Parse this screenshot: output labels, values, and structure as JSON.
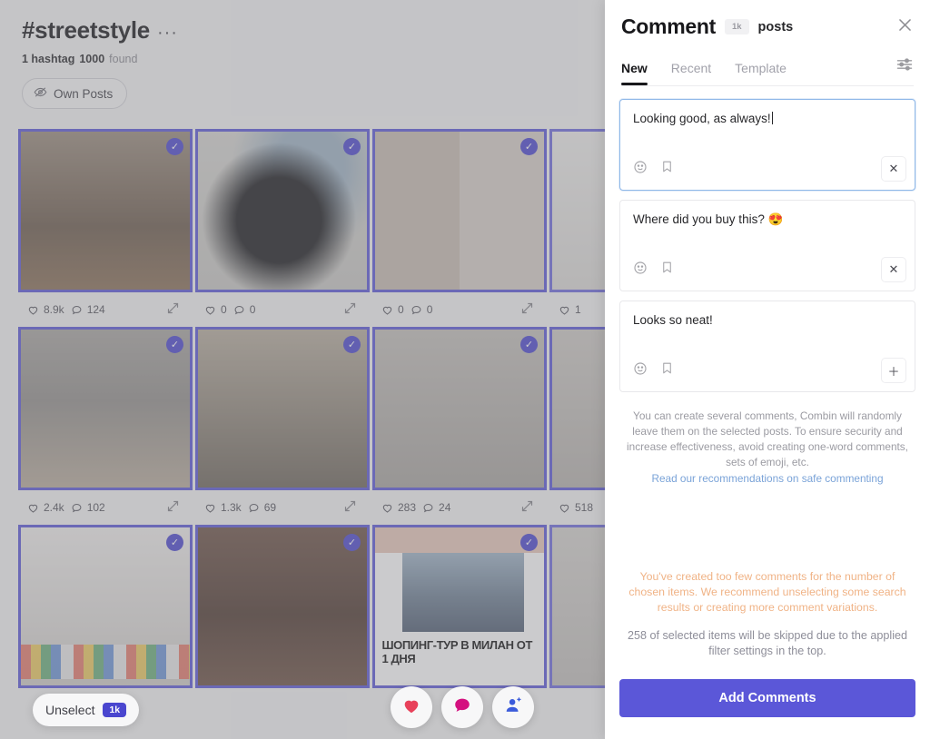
{
  "results": {
    "hashtag_title": "#streetstyle",
    "more_glyph": "···",
    "meta_count_label": "1 hashtag",
    "meta_found_value": "1000",
    "meta_found_label": "found",
    "own_posts_label": "Own Posts",
    "unselect_label": "Unselect",
    "unselect_count": "1k",
    "selected_check": "✓",
    "posts": [
      {
        "likes": "8.9k",
        "comments": "124",
        "selected": true,
        "thumb": "woman-on-bench-autumn"
      },
      {
        "likes": "0",
        "comments": "0",
        "selected": true,
        "thumb": "black-beanies-hoodie"
      },
      {
        "likes": "0",
        "comments": "0",
        "selected": true,
        "thumb": "floral-dress-collage"
      },
      {
        "likes": "1",
        "comments": "",
        "selected": false,
        "thumb": "white-interior"
      },
      {
        "likes": "2.4k",
        "comments": "102",
        "selected": true,
        "thumb": "beige-outfit-street"
      },
      {
        "likes": "1.3k",
        "comments": "69",
        "selected": true,
        "thumb": "floral-coat-canal"
      },
      {
        "likes": "283",
        "comments": "24",
        "selected": true,
        "thumb": "red-dress-stairs"
      },
      {
        "likes": "518",
        "comments": "",
        "selected": true,
        "thumb": "black-outfit"
      },
      {
        "likes": "",
        "comments": "",
        "selected": true,
        "thumb": "gallery-corridor"
      },
      {
        "likes": "",
        "comments": "",
        "selected": true,
        "thumb": "man-cafe-white-shirt"
      },
      {
        "likes": "",
        "comments": "",
        "selected": true,
        "thumb": "shopping-tour-poster"
      },
      {
        "likes": "",
        "comments": "",
        "selected": false,
        "thumb": "storefront"
      }
    ],
    "fabs": [
      {
        "name": "like-fab",
        "icon": "heart-icon",
        "color": "#e8415a"
      },
      {
        "name": "comment-fab",
        "icon": "comment-icon",
        "color": "#d4107f"
      },
      {
        "name": "follow-fab",
        "icon": "user-plus-icon",
        "color": "#3b5bdb"
      }
    ]
  },
  "panel": {
    "title": "Comment",
    "count_badge": "1k",
    "posts_label": "posts",
    "tabs": [
      {
        "label": "New",
        "active": true
      },
      {
        "label": "Recent",
        "active": false
      },
      {
        "label": "Template",
        "active": false
      }
    ],
    "comments": [
      {
        "text": "Looking good, as always!",
        "focused": true,
        "action": "remove",
        "action_glyph": "✕"
      },
      {
        "text": "Where did you buy this? 😍",
        "focused": false,
        "action": "remove",
        "action_glyph": "✕"
      },
      {
        "text": "Looks so neat!",
        "focused": false,
        "action": "add",
        "action_glyph": "＋"
      }
    ],
    "hint_text": "You can create several comments, Combin will randomly leave them on the selected posts. To ensure security and increase effectiveness, avoid creating one-word comments, sets of emoji, etc.",
    "hint_link": "Read our recommendations on safe commenting",
    "warning_orange": "You've created too few comments for the number of chosen items. We recommend unselecting some search results or creating more comment variations.",
    "warning_gray": "258 of selected items will be skipped due to the applied filter settings in the top.",
    "submit_label": "Add Comments",
    "accent_color": "#5b57d8",
    "warning_color": "#f0b386",
    "link_color": "#7aa3d8"
  }
}
